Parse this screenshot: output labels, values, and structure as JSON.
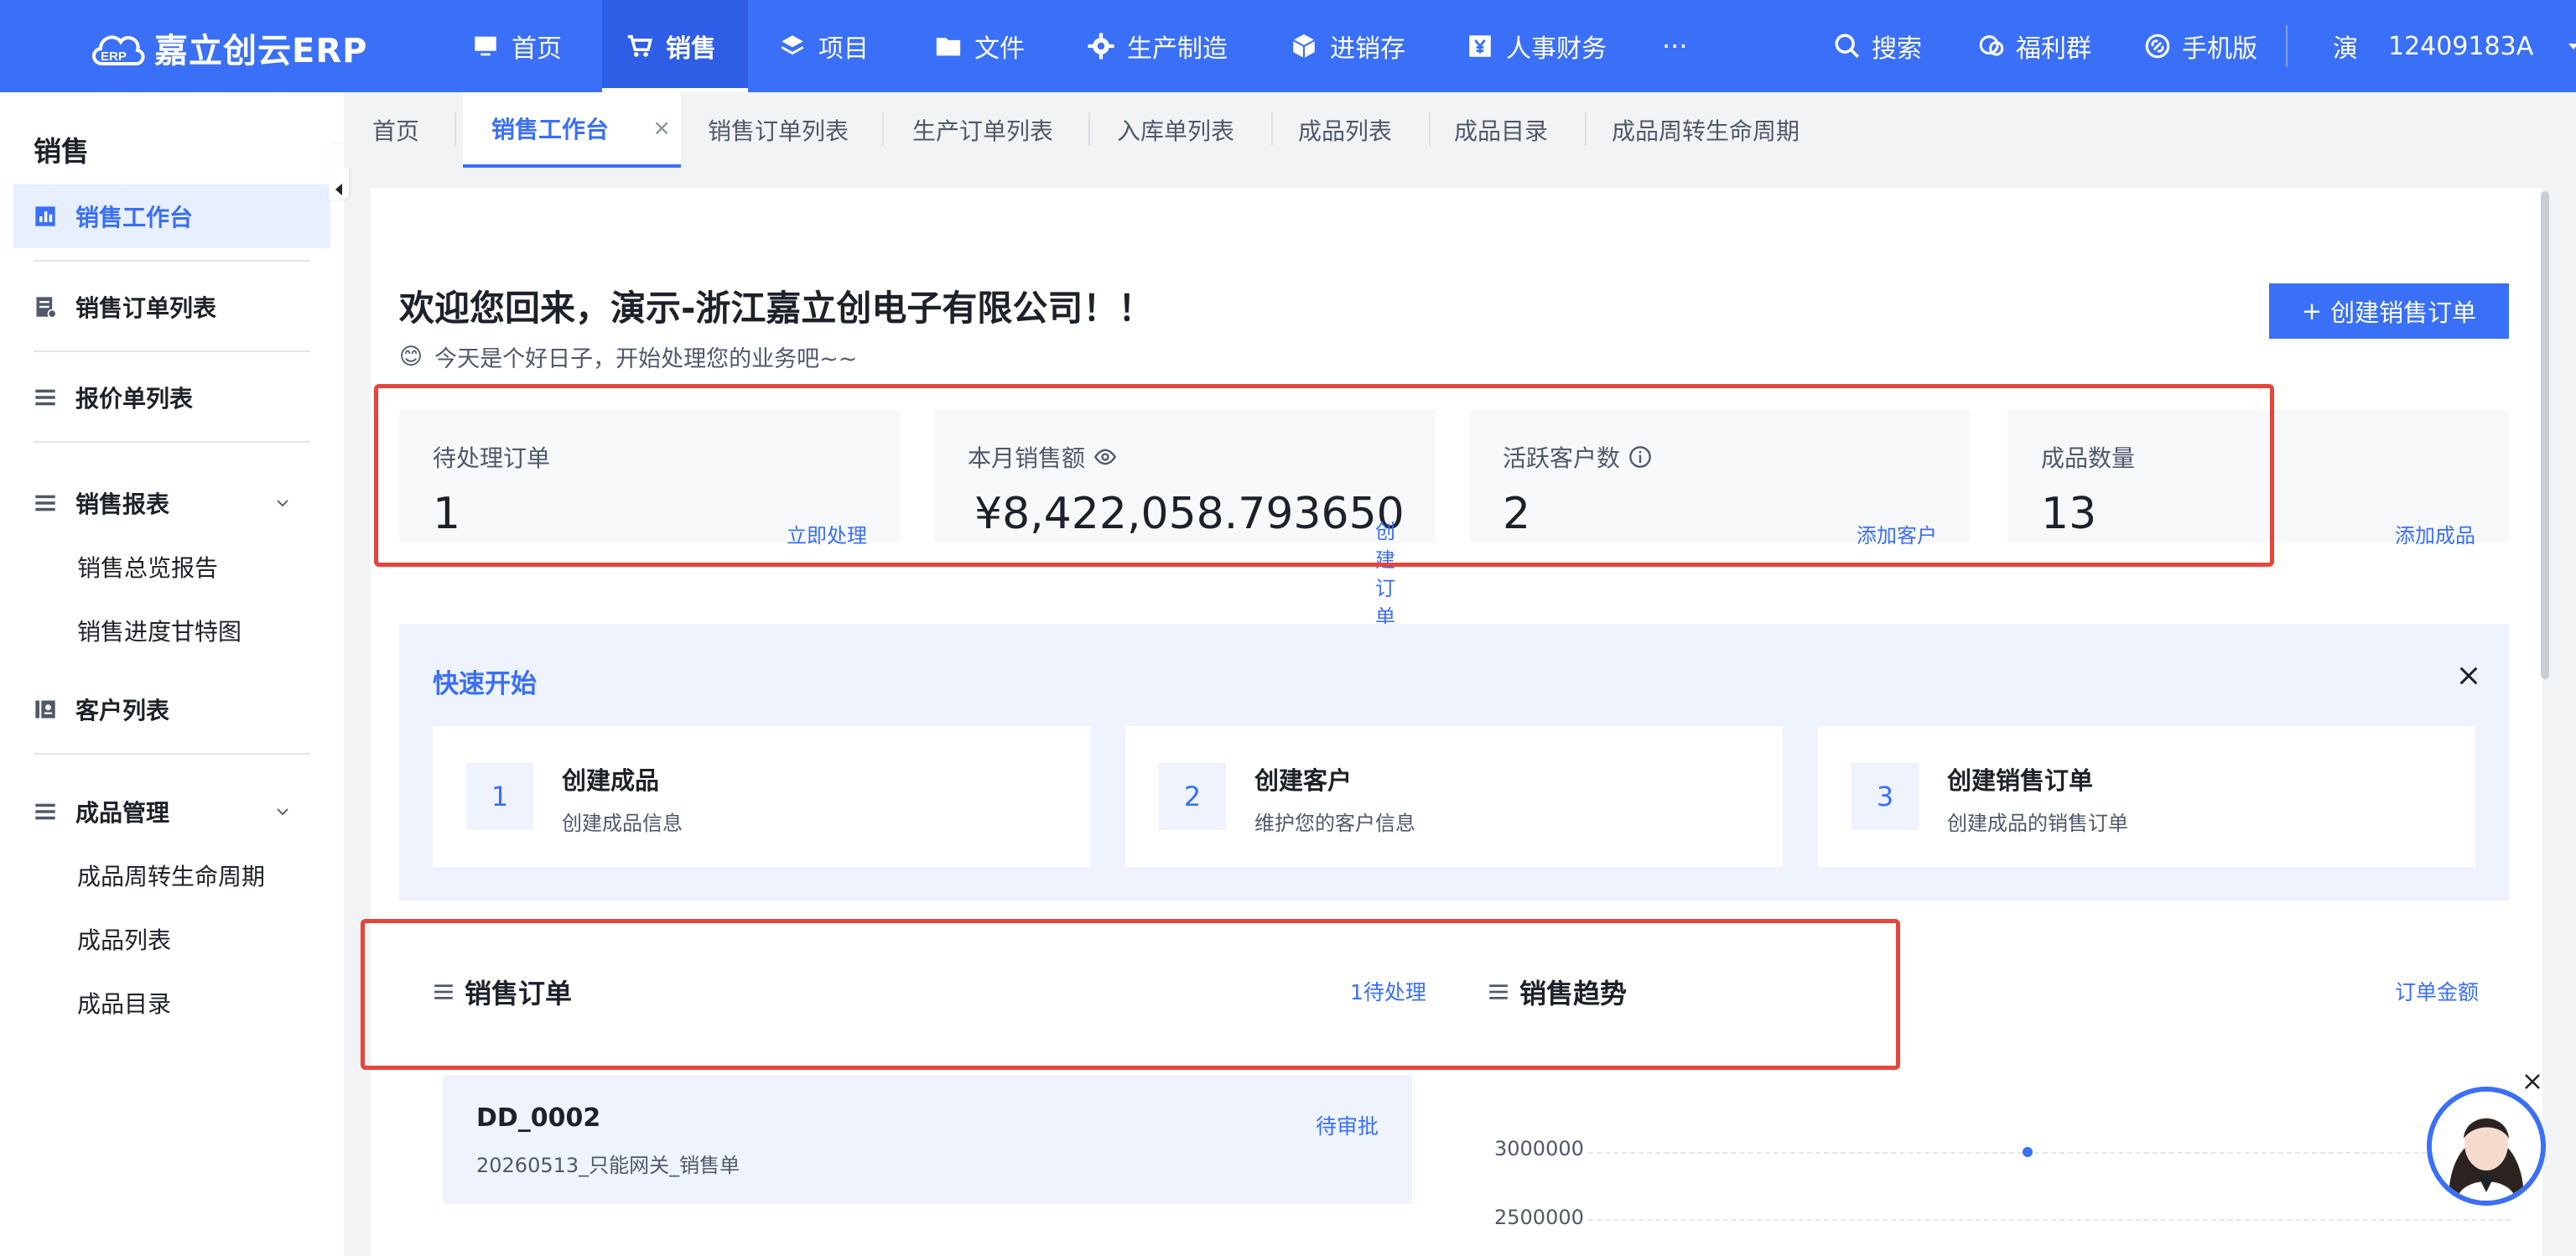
{
  "app": {
    "logo_text": "嘉立创云ERP",
    "logo_badge": "ERP"
  },
  "topnav": {
    "items": [
      {
        "label": "首页",
        "icon": "monitor-icon"
      },
      {
        "label": "销售",
        "icon": "cart-icon",
        "active": true
      },
      {
        "label": "项目",
        "icon": "layers-icon"
      },
      {
        "label": "文件",
        "icon": "folder-icon"
      },
      {
        "label": "生产制造",
        "icon": "gear-icon"
      },
      {
        "label": "进销存",
        "icon": "box-icon"
      },
      {
        "label": "人事财务",
        "icon": "yen-icon"
      }
    ],
    "more": "···",
    "search": "搜索",
    "welfare": "福利群",
    "mobile": "手机版",
    "user_avatar": "演",
    "user_id": "12409183A"
  },
  "sidebar": {
    "title": "销售",
    "items": [
      {
        "label": "销售工作台",
        "active": true
      },
      {
        "label": "销售订单列表"
      },
      {
        "label": "报价单列表"
      },
      {
        "label": "销售报表"
      },
      {
        "label": "客户列表"
      },
      {
        "label": "成品管理"
      }
    ],
    "report_sub": [
      "销售总览报告",
      "销售进度甘特图"
    ],
    "product_sub": [
      "成品周转生命周期",
      "成品列表",
      "成品目录"
    ]
  },
  "tabs": [
    "首页",
    "销售工作台",
    "销售订单列表",
    "生产订单列表",
    "入库单列表",
    "成品列表",
    "成品目录",
    "成品周转生命周期"
  ],
  "tab_close": "×",
  "welcome": {
    "title": "欢迎您回来，演示-浙江嘉立创电子有限公司！！",
    "emoji": "😊",
    "subtitle": "今天是个好日子，开始处理您的业务吧~~",
    "create_button": "创建销售订单",
    "create_plus": "+"
  },
  "stats": [
    {
      "label": "待处理订单",
      "value": "1",
      "link": "立即处理"
    },
    {
      "label": "本月销售额",
      "value": "¥8,422,058.793650",
      "link": "创建订单"
    },
    {
      "label": "活跃客户数",
      "value": "2",
      "link": "添加客户"
    },
    {
      "label": "成品数量",
      "value": "13",
      "link": "添加成品"
    }
  ],
  "quick_start": {
    "title": "快速开始",
    "cards": [
      {
        "num": "1",
        "title": "创建成品",
        "desc": "创建成品信息"
      },
      {
        "num": "2",
        "title": "创建客户",
        "desc": "维护您的客户信息"
      },
      {
        "num": "3",
        "title": "创建销售订单",
        "desc": "创建成品的销售订单"
      }
    ]
  },
  "sales_orders": {
    "title": "销售订单",
    "link": "1待处理",
    "order": {
      "id": "DD_0002",
      "desc": "20260513_只能网关_销售单",
      "status": "待审批"
    }
  },
  "sales_trend": {
    "title": "销售趋势",
    "link": "订单金额",
    "y_ticks": [
      "3000000",
      "2500000"
    ]
  },
  "colors": {
    "primary": "#3a6ff7",
    "highlight": "#e5453b"
  }
}
